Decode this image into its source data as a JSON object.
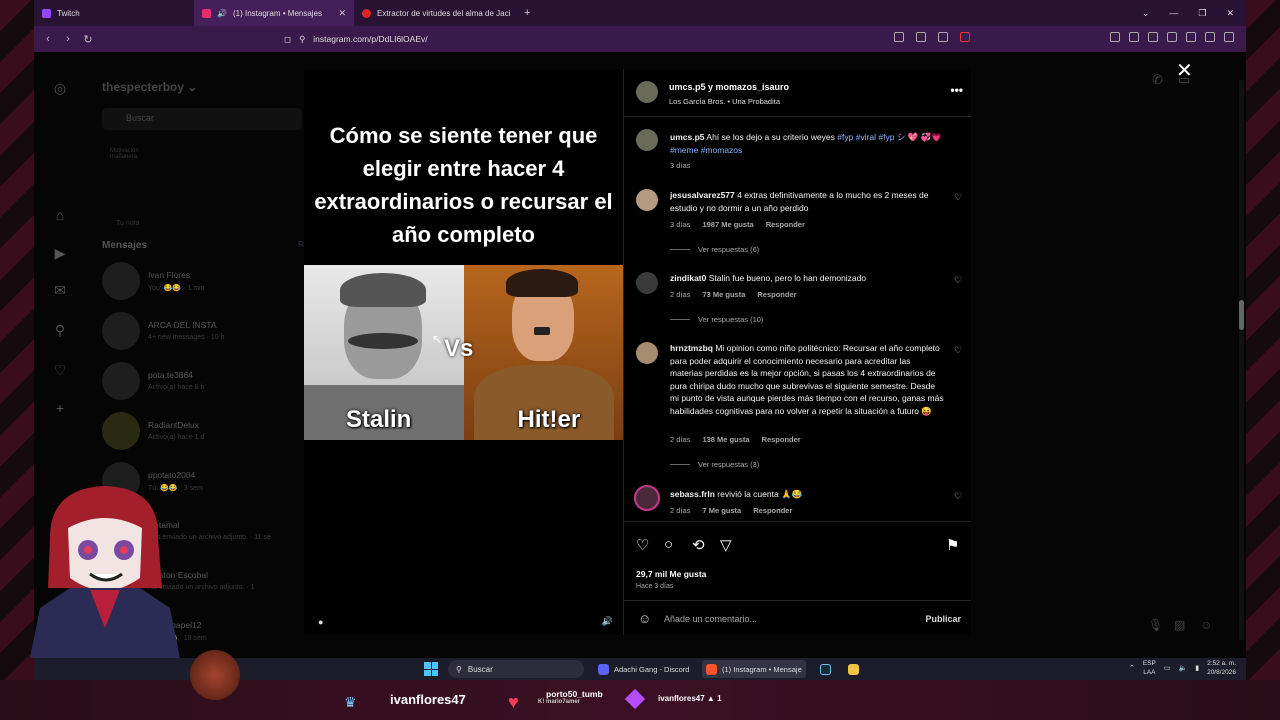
{
  "browser": {
    "tabs": [
      {
        "label": "Twitch",
        "color": "#9146ff"
      },
      {
        "label": "(1) Instagram • Mensajes",
        "color": "#e1306c",
        "active": true
      },
      {
        "label": "Extractor de virtudes del alma de Jaci",
        "color": "#e02424"
      }
    ],
    "url": "instagram.com/p/DdLI6lOAEv/"
  },
  "instagram": {
    "username": "thespecterboy",
    "search_placeholder": "Buscar",
    "note_text": "Motivación mañanera",
    "your_note": "Tu nota",
    "messages_heading": "Mensajes",
    "requests_label": "R",
    "conversations": [
      {
        "name": "Ivan Flores",
        "sub": "You: 😂😂 · 1 min"
      },
      {
        "name": "ARCA DEL INSTA",
        "sub": "4+ new messages · 10 h"
      },
      {
        "name": "pota.te3864",
        "sub": "Activo(a) hace 8 h"
      },
      {
        "name": "RadiantDelux",
        "sub": "Activo(a) hace 1 d"
      },
      {
        "name": "ppotato2004",
        "sub": "Tú: 😂😂 · 3 sem"
      },
      {
        "name": "Retamal",
        "sub": "Has enviado un archivo adjunto. · 11 se"
      },
      {
        "name": "Gaston Escobal",
        "sub": "Ha enviado un archivo adjunto. · 1"
      },
      {
        "name": "tinad_papel12",
        "sub": "Tú: 😂😂 · 19 sem"
      }
    ]
  },
  "post": {
    "meme_title": "Cómo se siente tener que elegir entre hacer 4 extraordinarios o recursar el año completo",
    "left_name": "Stalin",
    "vs": "Vs",
    "right_name": "Hit!er",
    "header_accounts": "umcs.p5 y momazos_isauro",
    "header_sub": "Los García Bros. • Una Probadita",
    "caption_user": "umcs.p5",
    "caption_text": "Ahí se los dejo a su criterio weyes",
    "caption_tags1": "#fyp #viral #fyp シ",
    "caption_emoji1": "💖",
    "caption_emoji2": "💞💗",
    "caption_tags2": "#meme #momazos",
    "caption_time": "3 días",
    "comments": [
      {
        "user": "jesusalvarez577",
        "text": "4 extras definitivamente a lo mucho es 2 meses de estudio y no dormir a un año perdido",
        "time": "3 días",
        "likes": "1987 Me gusta",
        "reply": "Responder",
        "replies": "Ver respuestas (6)"
      },
      {
        "user": "zindikat0",
        "text": "Stalin fue bueno, pero lo han demonizado",
        "time": "2 días",
        "likes": "73 Me gusta",
        "reply": "Responder",
        "replies": "Ver respuestas (10)"
      },
      {
        "user": "hrnztmzbq",
        "text": "Mi opinion como niño politécnico: Recursar el año completo para poder adquirir el conocimiento necesario para acreditar las materias perdidas es la mejor opción, si pasas los 4 extraordinarios de pura chiripa dudo mucho que subrevivas el siguiente semestre. Desde mi punto de vista aunque pierdes más tiempo con el recurso, ganas más habilidades cognitivas para no volver a repetir la situación a futuro 😝",
        "time": "2 días",
        "likes": "138 Me gusta",
        "reply": "Responder",
        "replies": "Ver respuestas (3)"
      },
      {
        "user": "sebass.frln",
        "text": "revivió la cuenta 🙏😂",
        "time": "2 días",
        "likes": "7 Me gusta",
        "reply": "Responder"
      }
    ],
    "likes_total": "29,7 mil Me gusta",
    "posted": "Hace 3 días",
    "add_comment_placeholder": "Añade un comentario...",
    "publish": "Publicar"
  },
  "taskbar": {
    "search": "Buscar",
    "apps": [
      "Adachi Gang - Discord",
      "(1) Instagram • Mensaje"
    ],
    "lang_line1": "ESP",
    "lang_line2": "LAA",
    "time": "2:52 a. m.",
    "date": "20/8/2026"
  },
  "overlay": {
    "streamer": "ivanflores47",
    "subscriber": "porto50_tumb",
    "subscriber2": "K! mario7amer",
    "follower": "ivanflores47",
    "follower_count": "1"
  }
}
